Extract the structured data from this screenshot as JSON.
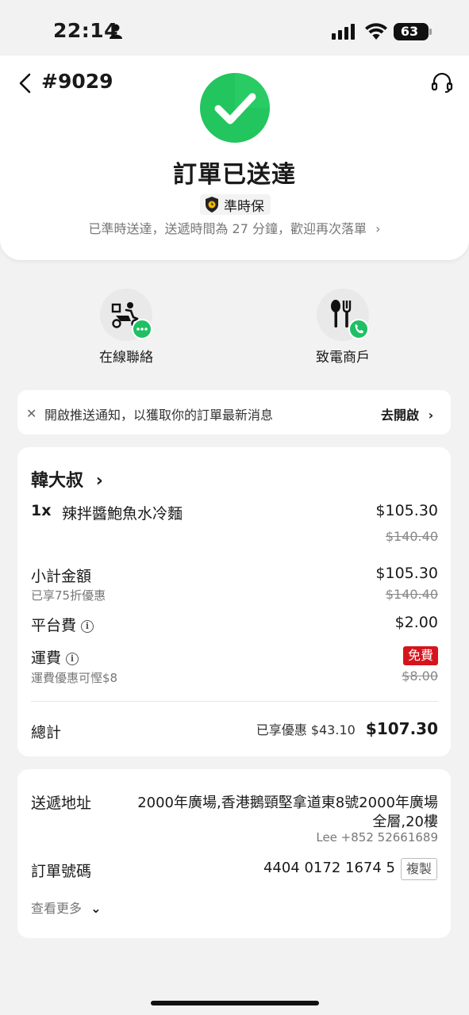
{
  "status_bar": {
    "time": "22:14",
    "battery": "63"
  },
  "header": {
    "order_number": "#9029",
    "status_title": "訂單已送達",
    "ontime_tag": "準時保",
    "delivery_note": "已準時送達，送遞時間為 27 分鐘，歡迎再次落單",
    "accent_color": "#22c55e"
  },
  "contacts": [
    {
      "label": "在線聯絡",
      "icon": "courier-chat-icon"
    },
    {
      "label": "致電商戶",
      "icon": "restaurant-phone-icon"
    }
  ],
  "notification": {
    "text": "開啟推送通知，以獲取你的訂單最新消息",
    "action": "去開啟"
  },
  "order": {
    "restaurant": "韓大叔",
    "item": {
      "quantity": "1x",
      "name": "辣拌醬鮑魚水冷麵",
      "price": "$105.30",
      "original_price": "$140.40"
    },
    "subtotal": {
      "label": "小計金額",
      "note": "已享75折優惠",
      "price": "$105.30",
      "original_price": "$140.40"
    },
    "platform_fee": {
      "label": "平台費",
      "price": "$2.00"
    },
    "delivery_fee": {
      "label": "運費",
      "note": "運費優惠可慳$8",
      "badge": "免費",
      "original_price": "$8.00",
      "badge_color": "#d6141c"
    },
    "total": {
      "label": "總計",
      "saved": "已享優惠 $43.10",
      "price": "$107.30"
    }
  },
  "details": {
    "address_label": "送遞地址",
    "address_line1": "2000年廣場,香港鵝頸堅拿道東8號2000年廣場",
    "address_line2": "全層,20樓",
    "contact": "Lee +852 52661689",
    "order_id_label": "訂單號碼",
    "order_id": "4404 0172 1674 5",
    "copy_label": "複製",
    "see_more": "查看更多"
  }
}
